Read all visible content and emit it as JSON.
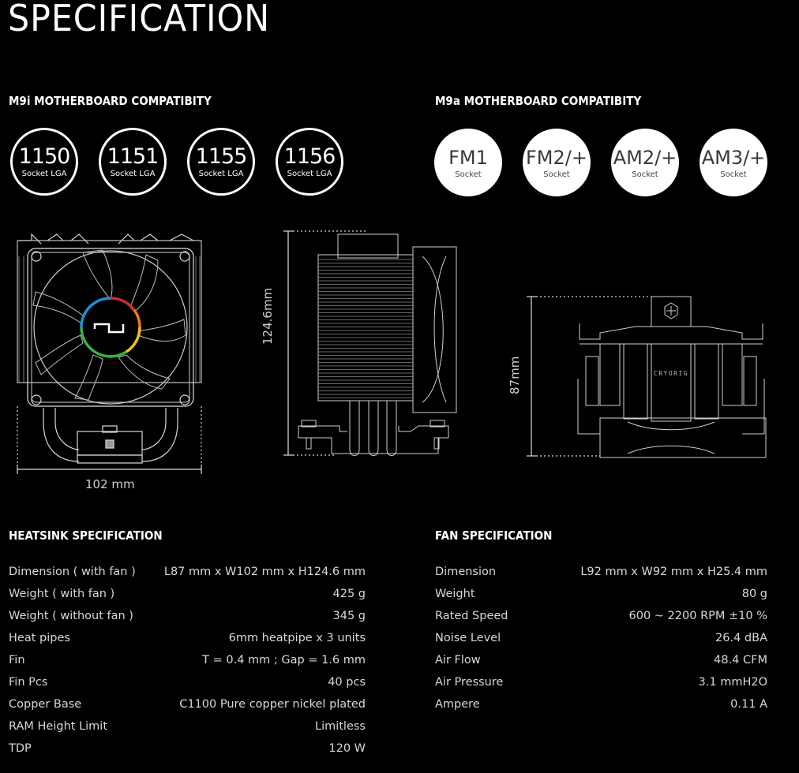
{
  "page_title": "SPECIFICATION",
  "m9i": {
    "heading": "M9i MOTHERBOARD COMPATIBITY",
    "sockets": [
      {
        "name": "1150",
        "sub": "Socket LGA"
      },
      {
        "name": "1151",
        "sub": "Socket LGA"
      },
      {
        "name": "1155",
        "sub": "Socket LGA"
      },
      {
        "name": "1156",
        "sub": "Socket LGA"
      }
    ]
  },
  "m9a": {
    "heading": "M9a MOTHERBOARD COMPATIBITY",
    "sockets": [
      {
        "name": "FM1",
        "sub": "Socket"
      },
      {
        "name": "FM2/+",
        "sub": "Socket"
      },
      {
        "name": "AM2/+",
        "sub": "Socket"
      },
      {
        "name": "AM3/+",
        "sub": "Socket"
      }
    ]
  },
  "diagrams": {
    "front_width_label": "102 mm",
    "side_height_label": "124.6mm",
    "top_height_label": "87mm",
    "brand_text": "CRYORIG",
    "ring_colors": [
      "#1e90d6",
      "#d22a2a",
      "#f07a1a",
      "#f4c21a",
      "#3cb043"
    ]
  },
  "heatsink": {
    "heading": "HEATSINK SPECIFICATION",
    "rows": [
      {
        "label": "Dimension ( with fan )",
        "value": "L87 mm x W102 mm x H124.6 mm"
      },
      {
        "label": "Weight ( with fan )",
        "value": "425 g"
      },
      {
        "label": "Weight ( without fan )",
        "value": "345 g"
      },
      {
        "label": "Heat pipes",
        "value": "6mm heatpipe x 3 units"
      },
      {
        "label": "Fin",
        "value": "T = 0.4 mm ; Gap = 1.6 mm"
      },
      {
        "label": "Fin Pcs",
        "value": "40 pcs"
      },
      {
        "label": "Copper Base",
        "value": "C1100 Pure copper nickel plated"
      },
      {
        "label": "RAM Height Limit",
        "value": "Limitless"
      },
      {
        "label": "TDP",
        "value": "120 W"
      }
    ]
  },
  "fan": {
    "heading": "FAN SPECIFICATION",
    "rows": [
      {
        "label": "Dimension",
        "value": "L92 mm x W92 mm x H25.4 mm"
      },
      {
        "label": "Weight",
        "value": "80 g"
      },
      {
        "label": "Rated Speed",
        "value": "600 ~ 2200 RPM ±10 %"
      },
      {
        "label": "Noise Level",
        "value": "26.4 dBA"
      },
      {
        "label": "Air Flow",
        "value": "48.4 CFM"
      },
      {
        "label": "Air Pressure",
        "value": "3.1 mmH2O"
      },
      {
        "label": "Ampere",
        "value": "0.11 A"
      }
    ]
  }
}
